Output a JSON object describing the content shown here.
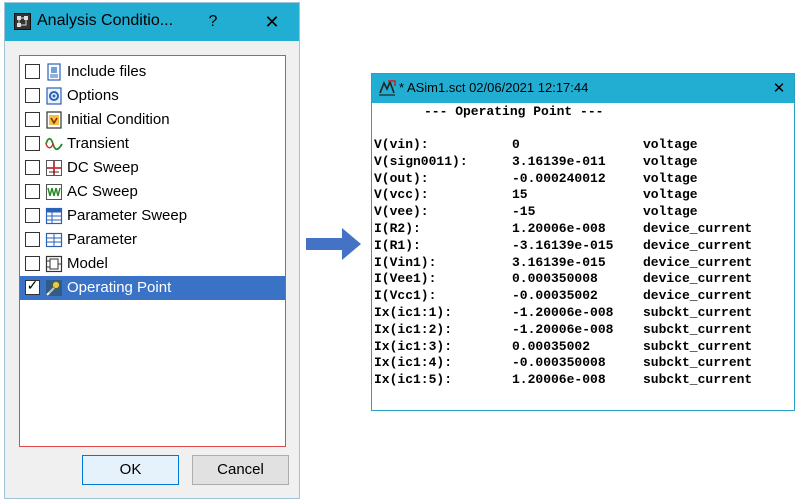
{
  "dialog": {
    "title": "Analysis Conditio...",
    "help_label": "?",
    "close_label": "✕",
    "items": [
      {
        "label": "Include files",
        "icon": "include-files-icon",
        "checked": false,
        "selected": false
      },
      {
        "label": "Options",
        "icon": "options-icon",
        "checked": false,
        "selected": false
      },
      {
        "label": "Initial Condition",
        "icon": "initial-condition-icon",
        "checked": false,
        "selected": false
      },
      {
        "label": "Transient",
        "icon": "transient-icon",
        "checked": false,
        "selected": false
      },
      {
        "label": "DC Sweep",
        "icon": "dc-sweep-icon",
        "checked": false,
        "selected": false
      },
      {
        "label": "AC Sweep",
        "icon": "ac-sweep-icon",
        "checked": false,
        "selected": false
      },
      {
        "label": "Parameter Sweep",
        "icon": "parameter-sweep-icon",
        "checked": false,
        "selected": false
      },
      {
        "label": "Parameter",
        "icon": "parameter-icon",
        "checked": false,
        "selected": false
      },
      {
        "label": "Model",
        "icon": "model-icon",
        "checked": false,
        "selected": false
      },
      {
        "label": "Operating Point",
        "icon": "operating-point-icon",
        "checked": true,
        "selected": true
      }
    ],
    "ok_label": "OK",
    "cancel_label": "Cancel"
  },
  "result_window": {
    "title": "* ASim1.sct 02/06/2021 12:17:44",
    "close_label": "✕",
    "heading": "--- Operating Point ---",
    "rows": [
      {
        "name": "V(vin):",
        "value": "0",
        "type": "voltage"
      },
      {
        "name": "V(sign0011):",
        "value": "3.16139e-011",
        "type": "voltage"
      },
      {
        "name": "V(out):",
        "value": "-0.000240012",
        "type": "voltage"
      },
      {
        "name": "V(vcc):",
        "value": "15",
        "type": "voltage"
      },
      {
        "name": "V(vee):",
        "value": "-15",
        "type": "voltage"
      },
      {
        "name": "I(R2):",
        "value": "1.20006e-008",
        "type": "device_current"
      },
      {
        "name": "I(R1):",
        "value": "-3.16139e-015",
        "type": "device_current"
      },
      {
        "name": "I(Vin1):",
        "value": "3.16139e-015",
        "type": "device_current"
      },
      {
        "name": "I(Vee1):",
        "value": "0.000350008",
        "type": "device_current"
      },
      {
        "name": "I(Vcc1):",
        "value": "-0.00035002",
        "type": "device_current"
      },
      {
        "name": "Ix(ic1:1):",
        "value": "-1.20006e-008",
        "type": "subckt_current"
      },
      {
        "name": "Ix(ic1:2):",
        "value": "-1.20006e-008",
        "type": "subckt_current"
      },
      {
        "name": "Ix(ic1:3):",
        "value": "0.00035002",
        "type": "subckt_current"
      },
      {
        "name": "Ix(ic1:4):",
        "value": "-0.000350008",
        "type": "subckt_current"
      },
      {
        "name": "Ix(ic1:5):",
        "value": "1.20006e-008",
        "type": "subckt_current"
      }
    ]
  },
  "colors": {
    "titlebar": "#22aed3",
    "selection": "#3a73c5",
    "list_border": "#e04a4a",
    "arrow": "#4472c4"
  }
}
